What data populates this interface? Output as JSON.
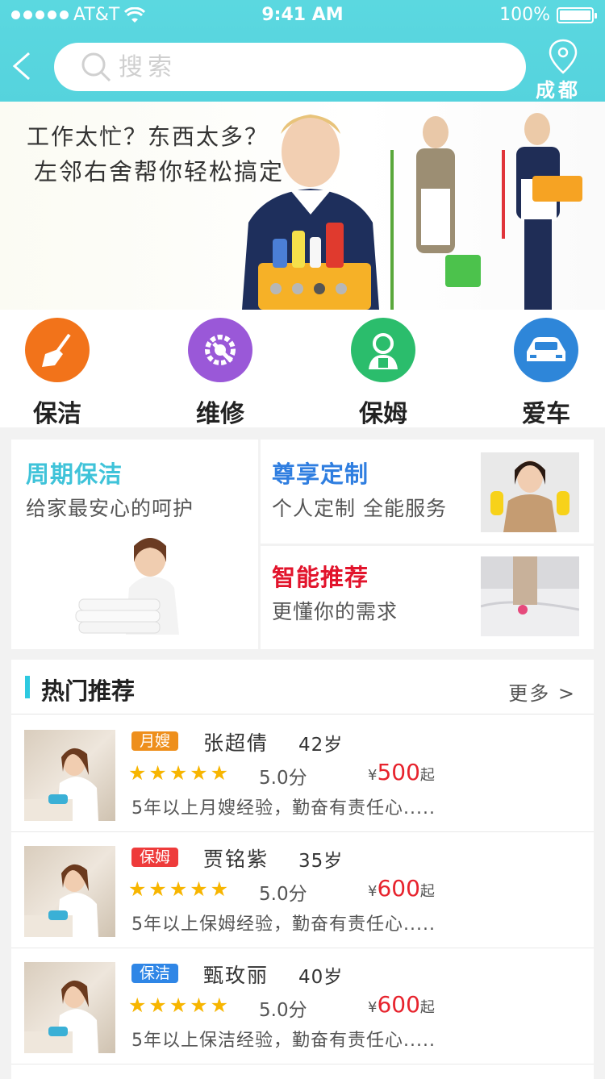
{
  "status": {
    "carrier": "AT&T",
    "time": "9:41 AM",
    "battery": "100%"
  },
  "header": {
    "search_placeholder": "搜索",
    "city": "成都"
  },
  "banner": {
    "line1": "工作太忙？东西太多？",
    "line2": "左邻右舍帮你轻松搞定",
    "page_count": 4,
    "active_page": 2
  },
  "categories": [
    {
      "label": "保洁",
      "icon": "broom-icon",
      "color": "#f2731a"
    },
    {
      "label": "维修",
      "icon": "gear-wrench-icon",
      "color": "#9a58d8"
    },
    {
      "label": "保姆",
      "icon": "nanny-icon",
      "color": "#2bbd6c"
    },
    {
      "label": "爱车",
      "icon": "car-icon",
      "color": "#2e86d9"
    }
  ],
  "promo": {
    "periodic": {
      "title": "周期保洁",
      "subtitle": "给家最安心的呵护",
      "title_color": "#3fc3d9"
    },
    "custom": {
      "title": "尊享定制",
      "subtitle": "个人定制   全能服务",
      "title_color": "#2f7ee0"
    },
    "smart": {
      "title": "智能推荐",
      "subtitle": "更懂你的需求",
      "title_color": "#e2142c"
    }
  },
  "hot": {
    "title": "热门推荐",
    "more": "更多 >",
    "items": [
      {
        "tag": "月嫂",
        "tag_color": "#ee8f1c",
        "name": "张超倩",
        "age": "42岁",
        "stars": "★★★★★",
        "score": "5.0分",
        "currency": "¥",
        "price": "500",
        "price_suffix": "起",
        "desc": "5年以上月嫂经验，勤奋有责任心....."
      },
      {
        "tag": "保姆",
        "tag_color": "#ee3b3b",
        "name": "贾铭紫",
        "age": "35岁",
        "stars": "★★★★★",
        "score": "5.0分",
        "currency": "¥",
        "price": "600",
        "price_suffix": "起",
        "desc": "5年以上保姆经验，勤奋有责任心....."
      },
      {
        "tag": "保洁",
        "tag_color": "#2f86e6",
        "name": "甄玫丽",
        "age": "40岁",
        "stars": "★★★★★",
        "score": "5.0分",
        "currency": "¥",
        "price": "600",
        "price_suffix": "起",
        "desc": "5年以上保洁经验，勤奋有责任心....."
      }
    ]
  }
}
